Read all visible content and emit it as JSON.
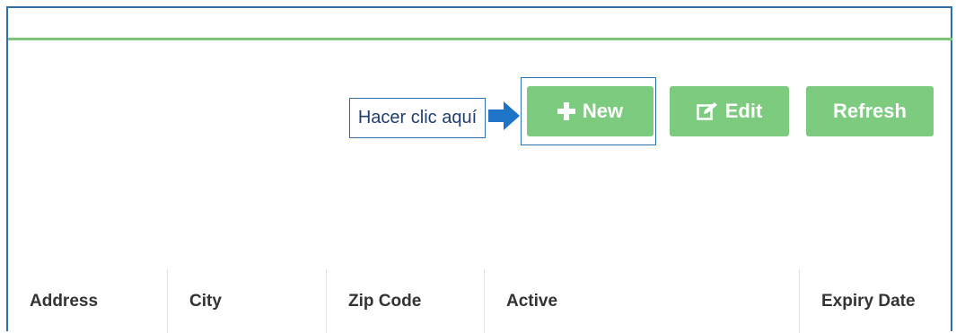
{
  "toolbar": {
    "new_label": "New",
    "edit_label": "Edit",
    "refresh_label": "Refresh"
  },
  "callout": {
    "text": "Hacer clic aquí"
  },
  "table": {
    "columns": [
      "Address",
      "City",
      "Zip Code",
      "Active",
      "Expiry Date"
    ]
  },
  "colors": {
    "button": "#7ccb7f",
    "frame": "#2e6fa8",
    "rule": "#7cc47a",
    "arrow": "#1e74c6"
  },
  "icons": {
    "new": "plus-icon",
    "edit": "edit-icon",
    "arrow": "arrow-right-icon"
  }
}
